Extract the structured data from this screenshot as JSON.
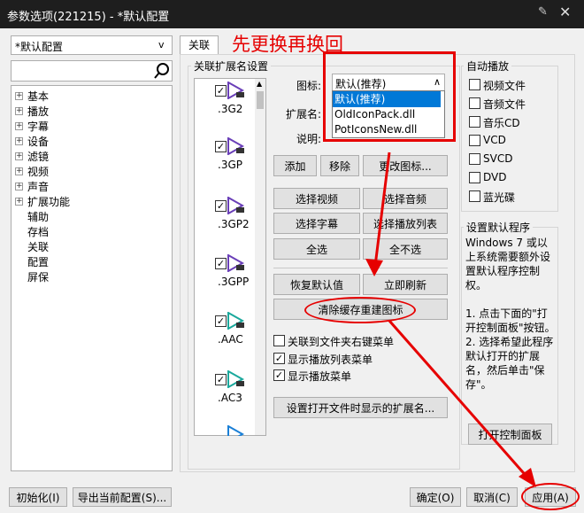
{
  "window": {
    "title": "参数选项(221215) - *默认配置"
  },
  "annotation": {
    "title": "先更换再换回"
  },
  "left": {
    "config_select": "*默认配置"
  },
  "tree": [
    "基本",
    "播放",
    "字幕",
    "设备",
    "滤镜",
    "视频",
    "声音",
    "扩展功能",
    "辅助",
    "存档",
    "关联",
    "配置",
    "屏保"
  ],
  "tab": {
    "label": "关联"
  },
  "ext_group": {
    "title": "关联扩展名设置"
  },
  "extensions": [
    {
      "name": ".3G2"
    },
    {
      "name": ".3GP"
    },
    {
      "name": ".3GP2"
    },
    {
      "name": ".3GPP"
    },
    {
      "name": ".AAC"
    },
    {
      "name": ".AC3"
    }
  ],
  "fields": {
    "icon_label": "图标:",
    "icon_value": "默认(推荐)",
    "icon_options": [
      "默认(推荐)",
      "OldIconPack.dll",
      "PotIconsNew.dll"
    ],
    "ext_label": "扩展名:",
    "desc_label": "说明:"
  },
  "buttons": {
    "add": "添加",
    "remove": "移除",
    "change_icon": "更改图标...",
    "select_video": "选择视频",
    "select_audio": "选择音频",
    "select_subtitle": "选择字幕",
    "select_playlist": "选择播放列表",
    "select_all": "全选",
    "select_none": "全不选",
    "restore_default": "恢复默认值",
    "refresh_now": "立即刷新",
    "clear_cache": "清除缓存重建图标",
    "set_open_ext": "设置打开文件时显示的扩展名..."
  },
  "options": [
    {
      "label": "关联到文件夹右键菜单"
    },
    {
      "label": "显示播放列表菜单"
    },
    {
      "label": "显示播放菜单"
    }
  ],
  "autoplay": {
    "title": "自动播放",
    "items": [
      "视频文件",
      "音频文件",
      "音乐CD",
      "VCD",
      "SVCD",
      "DVD",
      "蓝光碟"
    ]
  },
  "default_program": {
    "title": "设置默认程序",
    "text": "Windows 7 或以上系统需要额外设置默认程序控制权。\n\n1. 点击下面的\"打开控制面板\"按钮。\n2. 选择希望此程序默认打开的扩展名，然后单击\"保存\"。",
    "button": "打开控制面板"
  },
  "footer": {
    "init": "初始化(I)",
    "export": "导出当前配置(S)...",
    "ok": "确定(O)",
    "cancel": "取消(C)",
    "apply": "应用(A)"
  }
}
